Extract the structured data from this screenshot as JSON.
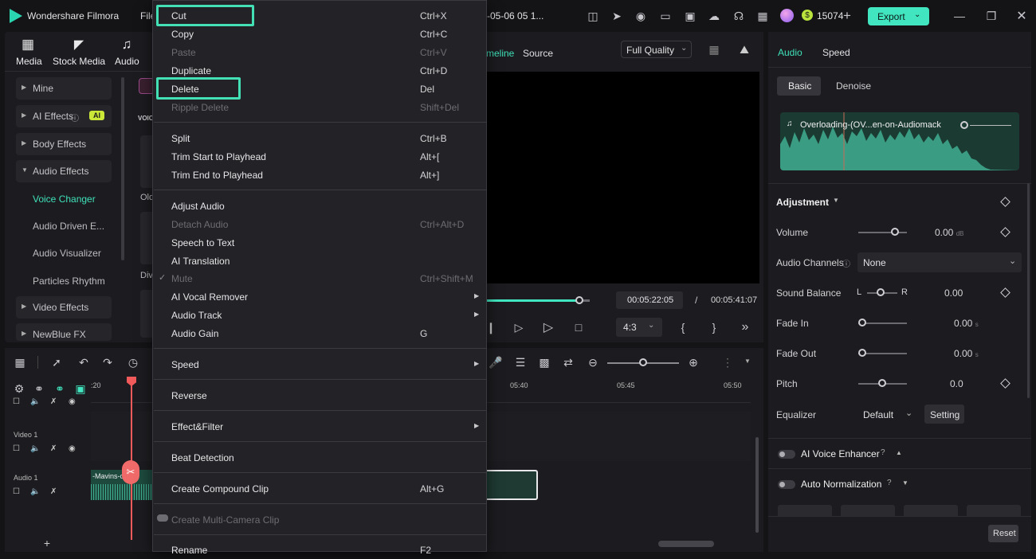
{
  "app": {
    "title": "Wondershare Filmora",
    "menu_file": "File",
    "project_title": "-05-06 05 1...",
    "coins": "15074",
    "export_label": "Export"
  },
  "colors": {
    "accent": "#41e5bf",
    "highlight": "#43e0b6",
    "playhead": "#f05a5a"
  },
  "media_tabs": [
    {
      "label": "Media",
      "icon": "media-icon"
    },
    {
      "label": "Stock Media",
      "icon": "stock-media-icon"
    },
    {
      "label": "Audio",
      "icon": "music-note-icon"
    }
  ],
  "sidebar": {
    "items": [
      {
        "label": "Mine"
      },
      {
        "label": "AI Effects",
        "badge": "AI"
      },
      {
        "label": "Body Effects"
      },
      {
        "label": "Audio Effects"
      },
      {
        "label": "Video Effects"
      },
      {
        "label": "NewBlue FX"
      }
    ],
    "subitems": [
      "Voice Changer",
      "Audio Driven E...",
      "Audio Visualizer",
      "Particles Rhythm"
    ]
  },
  "effects_panel": {
    "section_label": "VOIC",
    "old_label": "Old",
    "div_label": "Div"
  },
  "preview": {
    "tab_timeline": "meline",
    "tab_source": "Source",
    "quality": "Full Quality",
    "current_time": "00:05:22:05",
    "separator": "/",
    "total_time": "00:05:41:07",
    "aspect": "4:3"
  },
  "context_menu": {
    "items": [
      {
        "label": "Cut",
        "shortcut": "Ctrl+X",
        "enabled": true
      },
      {
        "label": "Copy",
        "shortcut": "Ctrl+C",
        "enabled": true
      },
      {
        "label": "Paste",
        "shortcut": "Ctrl+V",
        "enabled": false
      },
      {
        "label": "Duplicate",
        "shortcut": "Ctrl+D",
        "enabled": true
      },
      {
        "label": "Delete",
        "shortcut": "Del",
        "enabled": true
      },
      {
        "label": "Ripple Delete",
        "shortcut": "Shift+Del",
        "enabled": false
      },
      {
        "label": "Split",
        "shortcut": "Ctrl+B",
        "enabled": true
      },
      {
        "label": "Trim Start to Playhead",
        "shortcut": "Alt+[",
        "enabled": true
      },
      {
        "label": "Trim End to Playhead",
        "shortcut": "Alt+]",
        "enabled": true
      },
      {
        "label": "Adjust Audio",
        "shortcut": "",
        "enabled": true
      },
      {
        "label": "Detach Audio",
        "shortcut": "Ctrl+Alt+D",
        "enabled": false
      },
      {
        "label": "Speech to Text",
        "shortcut": "",
        "enabled": true
      },
      {
        "label": "AI Translation",
        "shortcut": "",
        "enabled": true
      },
      {
        "label": "Mute",
        "shortcut": "Ctrl+Shift+M",
        "enabled": false,
        "checked": true
      },
      {
        "label": "AI Vocal Remover",
        "shortcut": "",
        "enabled": true,
        "submenu": true
      },
      {
        "label": "Audio Track",
        "shortcut": "",
        "enabled": true,
        "submenu": true
      },
      {
        "label": "Audio Gain",
        "shortcut": "G",
        "enabled": true
      },
      {
        "label": "Speed",
        "shortcut": "",
        "enabled": true,
        "submenu": true
      },
      {
        "label": "Reverse",
        "shortcut": "",
        "enabled": true
      },
      {
        "label": "Effect&Filter",
        "shortcut": "",
        "enabled": true,
        "submenu": true
      },
      {
        "label": "Beat Detection",
        "shortcut": "",
        "enabled": true
      },
      {
        "label": "Create Compound Clip",
        "shortcut": "Alt+G",
        "enabled": true
      },
      {
        "label": "Create Multi-Camera Clip",
        "shortcut": "",
        "enabled": false
      },
      {
        "label": "Rename",
        "shortcut": "F2",
        "enabled": true
      }
    ]
  },
  "timeline": {
    "ruler": [
      ":20",
      "05:40",
      "05:45",
      "05:50"
    ],
    "tracks": [
      {
        "label": "Video 1"
      },
      {
        "label": "Audio 1"
      }
    ],
    "audio_clip_label": "-Mavins-on-a"
  },
  "right_panel": {
    "tabs": [
      "Audio",
      "Speed"
    ],
    "subtabs": [
      "Basic",
      "Denoise"
    ],
    "clip_name": "Overloading-(OV...en-on-Audiomack",
    "adjustment_label": "Adjustment",
    "volume": {
      "label": "Volume",
      "value": "0.00",
      "unit": "dB",
      "level": 0.75
    },
    "audio_channels": {
      "label": "Audio Channels",
      "value": "None"
    },
    "sound_balance": {
      "label": "Sound Balance",
      "left": "L",
      "right": "R",
      "value": "0.00",
      "level": 0.5
    },
    "fade_in": {
      "label": "Fade In",
      "value": "0.00",
      "unit": "s",
      "level": 0
    },
    "fade_out": {
      "label": "Fade Out",
      "value": "0.00",
      "unit": "s",
      "level": 0
    },
    "pitch": {
      "label": "Pitch",
      "value": "0.0",
      "level": 0.5
    },
    "equalizer": {
      "label": "Equalizer",
      "value": "Default",
      "setting_label": "Setting"
    },
    "ai_voice_enhancer": "AI Voice Enhancer",
    "auto_normalization": "Auto Normalization",
    "reset_label": "Reset"
  }
}
